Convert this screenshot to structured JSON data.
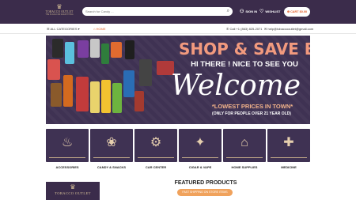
{
  "header": {
    "logo": {
      "name": "TOBACCO OUTLET",
      "tagline": "THE PLACE FOR EVERYTHING"
    },
    "search": {
      "placeholder": "Search for Candy ..."
    },
    "signin_label": "SIGN IN",
    "wishlist_label": "WISHLIST",
    "cart_label": "CART $0.00",
    "colors": {
      "bar": "#3b2c4b",
      "accent": "#e35b24"
    }
  },
  "nav": {
    "categories_label": "ALL CATEGORIES",
    "home_label": "HOME",
    "phone": "Call +1 (863) 825-2071",
    "email": "help@tobaccooutlet@gmail.com"
  },
  "hero": {
    "headline": "SHOP & SAVE BIG",
    "greeting": "HI THERE ! NICE TO SEE YOU",
    "script": "Welcome",
    "promo": "*LOWEST PRICES IN TOWN*",
    "disclaimer": "(ONLY FOR PEOPLE OVER 21 YEAR OLD)"
  },
  "categories": [
    {
      "label": "ACCESSORIES",
      "icon": "pipe-lighter-icon"
    },
    {
      "label": "CANDY & SNACKS",
      "icon": "candy-icon"
    },
    {
      "label": "CAR CENTER",
      "icon": "car-icon"
    },
    {
      "label": "CIGAR & VAPE",
      "icon": "cigar-icon"
    },
    {
      "label": "HOME SUPPLIES",
      "icon": "home-supplies-icon"
    },
    {
      "label": "MEDICINE",
      "icon": "medicine-icon"
    }
  ],
  "featured": {
    "title": "FEATURED PRODUCTS",
    "button_label": "FAST SHIPPING ON STORE ITEMS"
  },
  "promo_logo": {
    "name": "TOBACCO OUTLET"
  }
}
